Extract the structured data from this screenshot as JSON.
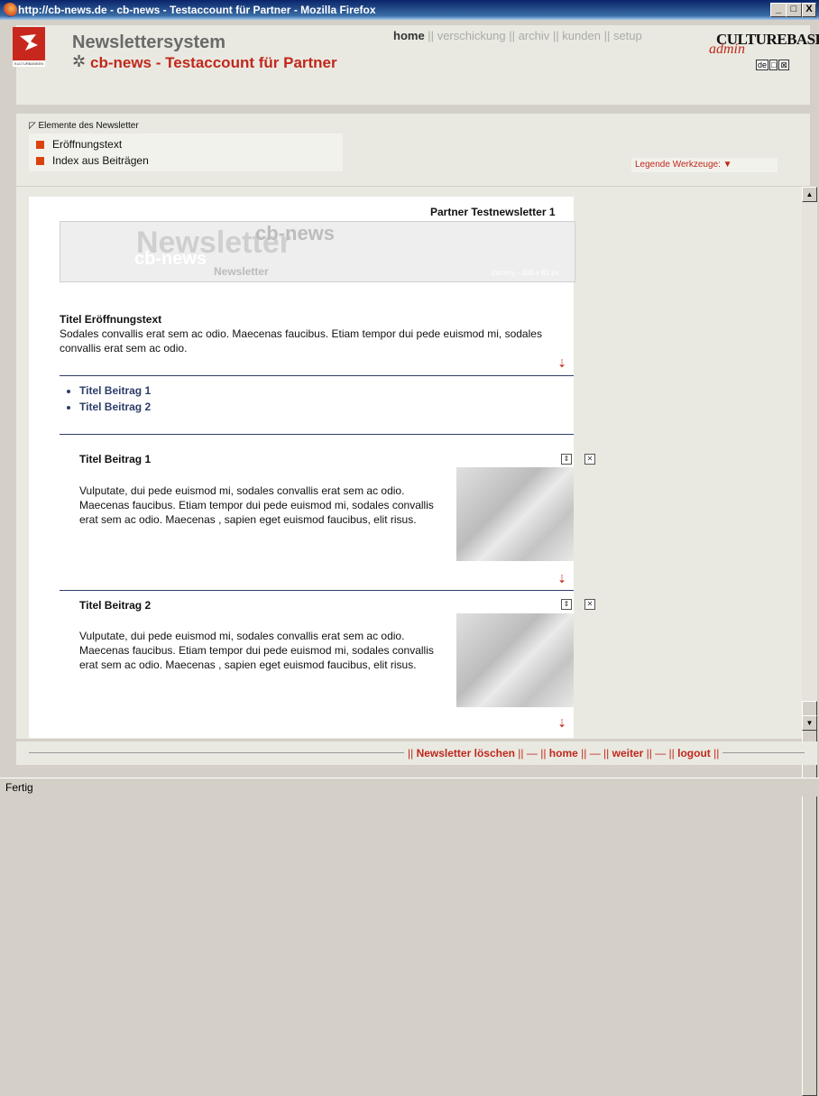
{
  "window": {
    "title": "http://cb-news.de - cb-news - Testaccount für Partner - Mozilla Firefox",
    "buttons": [
      "_",
      "□",
      "X"
    ]
  },
  "header": {
    "logo_label": "KULTURBANKEN",
    "app_name": "Newslettersystem",
    "account_name": "cb-news - Testaccount für Partner",
    "nav": [
      {
        "label": "home",
        "active": true
      },
      {
        "label": "verschickung",
        "active": false
      },
      {
        "label": "archiv",
        "active": false
      },
      {
        "label": "kunden",
        "active": false
      },
      {
        "label": "setup",
        "active": false
      }
    ],
    "nav_separator": "||",
    "brand": {
      "name": "CULTUREBASE",
      "sub": "admin",
      "tools": [
        "de",
        "□",
        "⊠"
      ]
    }
  },
  "elements_panel": {
    "title": "Elemente des Newsletter",
    "items": [
      "Eröffnungstext",
      "Index aus Beiträgen"
    ],
    "legend_label": "Legende Werkzeuge:"
  },
  "newsletter": {
    "title": "Partner Testnewsletter 1",
    "banner": {
      "line1": "Newsletter",
      "line2": "cb-news",
      "line3": "cb-news",
      "line4": "Newsletter",
      "caption": "dummy - 300 x 61 px"
    },
    "intro": {
      "heading": "Titel Eröffnungstext",
      "text": "Sodales convallis erat sem ac odio. Maecenas faucibus. Etiam tempor dui pede euismod mi, sodales convallis erat sem ac odio."
    },
    "index": [
      "Titel Beitrag 1",
      "Titel Beitrag 2"
    ],
    "articles": [
      {
        "heading": "Titel Beitrag 1",
        "text": "Vulputate, dui pede euismod mi, sodales convallis erat sem ac odio. Maecenas faucibus. Etiam tempor dui pede euismod mi, sodales convallis erat sem ac odio. Maecenas , sapien eget euismod faucibus, elit risus."
      },
      {
        "heading": "Titel Beitrag 2",
        "text": "Vulputate, dui pede euismod mi, sodales convallis erat sem ac odio. Maecenas faucibus. Etiam tempor dui pede euismod mi, sodales convallis erat sem ac odio. Maecenas , sapien eget euismod faucibus, elit risus."
      }
    ]
  },
  "footer_nav": {
    "delete": "Newsletter löschen",
    "home": "home",
    "next": "weiter",
    "logout": "logout"
  },
  "status": "Fertig"
}
